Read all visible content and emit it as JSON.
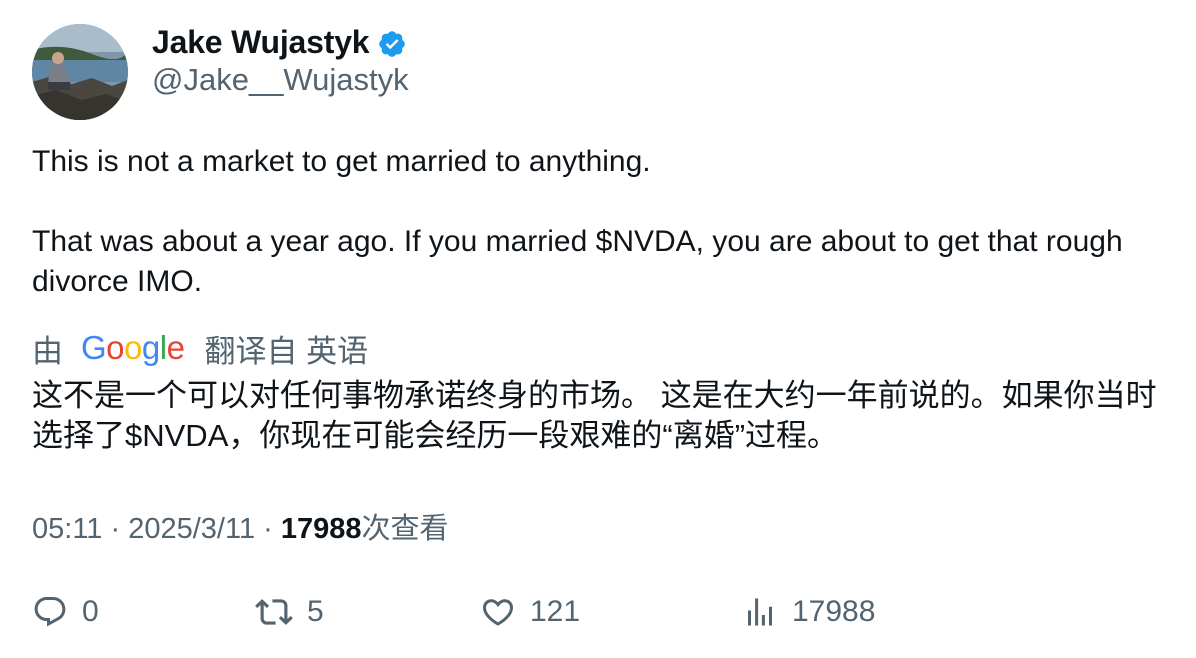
{
  "author": {
    "name": "Jake Wujastyk",
    "handle": "@Jake__Wujastyk",
    "verified": true
  },
  "tweet": {
    "paragraphs": [
      "This is not a market to get married to anything.",
      "That was about a year ago. If you married $NVDA, you are about to get that rough divorce IMO."
    ]
  },
  "translation": {
    "by": "由",
    "provider": "Google",
    "provider_letters": [
      "G",
      "o",
      "o",
      "g",
      "l",
      "e"
    ],
    "provider_colors": [
      "#4285F4",
      "#EA4335",
      "#FBBC05",
      "#4285F4",
      "#34A853",
      "#EA4335"
    ],
    "from_label": "翻译自 英语",
    "text": "这不是一个可以对任何事物承诺终身的市场。 这是在大约一年前说的。如果你当时选择了$NVDA，你现在可能会经历一段艰难的“离婚”过程。"
  },
  "meta": {
    "time": "05:11",
    "separator": "·",
    "date": "2025/3/11",
    "views_count": "17988",
    "views_label": "次查看"
  },
  "actions": {
    "replies": "0",
    "retweets": "5",
    "likes": "121",
    "views": "17988"
  },
  "colors": {
    "text_primary": "#0f1419",
    "text_secondary": "#536471",
    "verified_blue": "#1d9bf0"
  },
  "icons": {
    "verified": "verified-badge-icon",
    "reply": "reply-icon",
    "retweet": "retweet-icon",
    "like": "heart-icon",
    "views": "analytics-icon"
  }
}
